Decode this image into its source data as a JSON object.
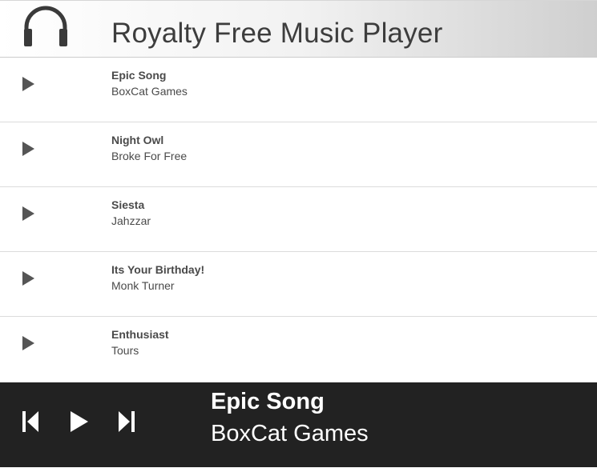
{
  "header": {
    "title": "Royalty Free Music Player",
    "icon": "headphones-icon"
  },
  "tracks": [
    {
      "title": "Epic Song",
      "artist": "BoxCat Games"
    },
    {
      "title": "Night Owl",
      "artist": "Broke For Free"
    },
    {
      "title": "Siesta",
      "artist": "Jahzzar"
    },
    {
      "title": "Its Your Birthday!",
      "artist": "Monk Turner"
    },
    {
      "title": "Enthusiast",
      "artist": "Tours"
    }
  ],
  "now_playing": {
    "title": "Epic Song",
    "artist": "BoxCat Games"
  },
  "controls": {
    "previous_icon": "skip-previous-icon",
    "play_icon": "play-icon",
    "next_icon": "skip-next-icon"
  },
  "colors": {
    "player_background": "#222222",
    "text": "#4a4a4a",
    "icon": "#555555",
    "player_text": "#ffffff"
  }
}
